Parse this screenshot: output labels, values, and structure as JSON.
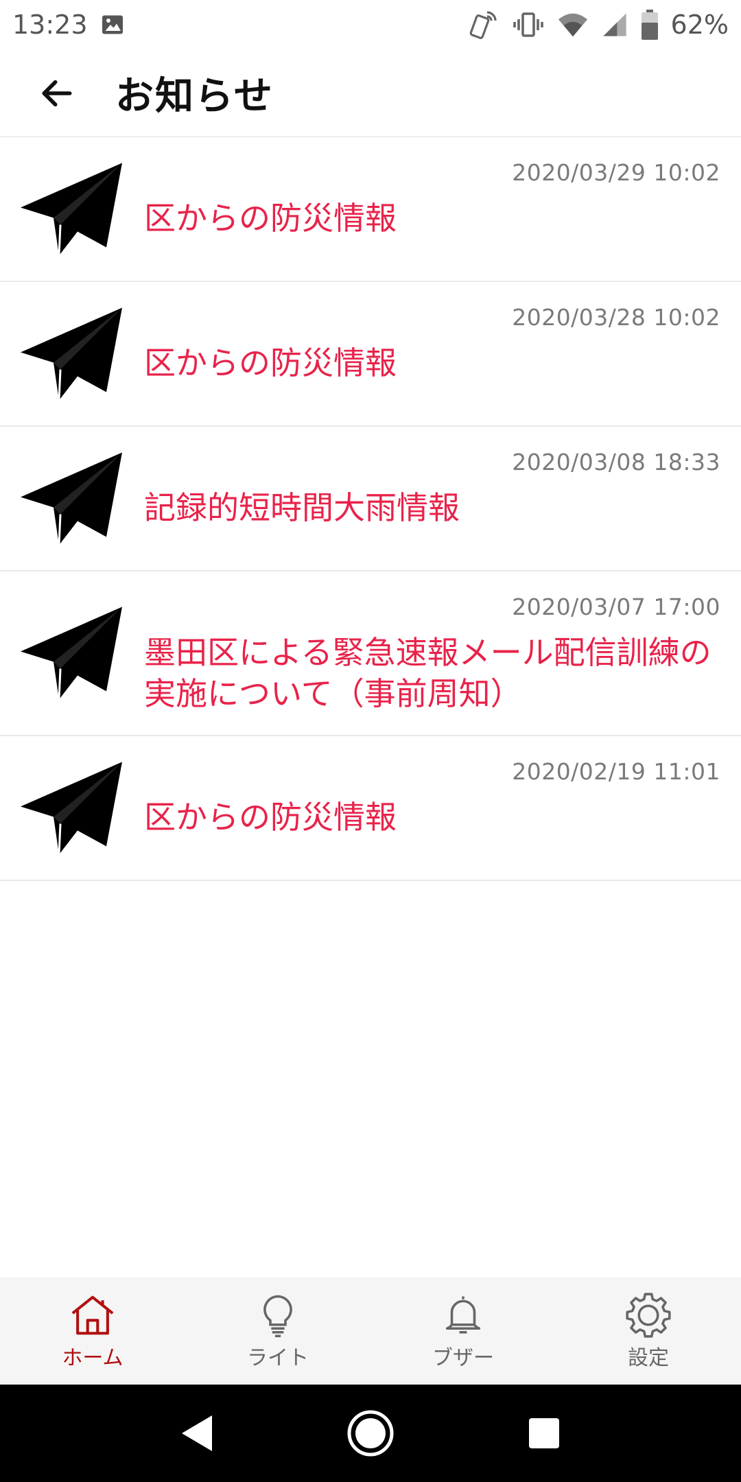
{
  "status_bar": {
    "time": "13:23",
    "battery": "62%",
    "icons": [
      "image-icon",
      "nfc-phone-icon",
      "vibrate-icon",
      "wifi-icon",
      "signal-icon",
      "battery-icon"
    ]
  },
  "app_bar": {
    "title": "お知らせ",
    "back_icon": "arrow-left-icon"
  },
  "notices": [
    {
      "date": "2020/03/29 10:02",
      "title": "区からの防災情報",
      "icon": "paper-plane-icon"
    },
    {
      "date": "2020/03/28 10:02",
      "title": "区からの防災情報",
      "icon": "paper-plane-icon"
    },
    {
      "date": "2020/03/08 18:33",
      "title": "記録的短時間大雨情報",
      "icon": "paper-plane-icon"
    },
    {
      "date": "2020/03/07 17:00",
      "title": "墨田区による緊急速報メール配信訓練の実施について（事前周知）",
      "icon": "paper-plane-icon"
    },
    {
      "date": "2020/02/19 11:01",
      "title": "区からの防災情報",
      "icon": "paper-plane-icon"
    }
  ],
  "bottom_nav": {
    "active": "home",
    "items": [
      {
        "id": "home",
        "label": "ホーム",
        "icon": "home-icon"
      },
      {
        "id": "light",
        "label": "ライト",
        "icon": "lightbulb-icon"
      },
      {
        "id": "buzzer",
        "label": "ブザー",
        "icon": "bell-icon"
      },
      {
        "id": "settings",
        "label": "設定",
        "icon": "gear-icon"
      }
    ]
  },
  "colors": {
    "accent": "#e8234a",
    "active_nav": "#b01010",
    "date_text": "#7a7a7a",
    "nav_background": "#f5f5f5"
  }
}
